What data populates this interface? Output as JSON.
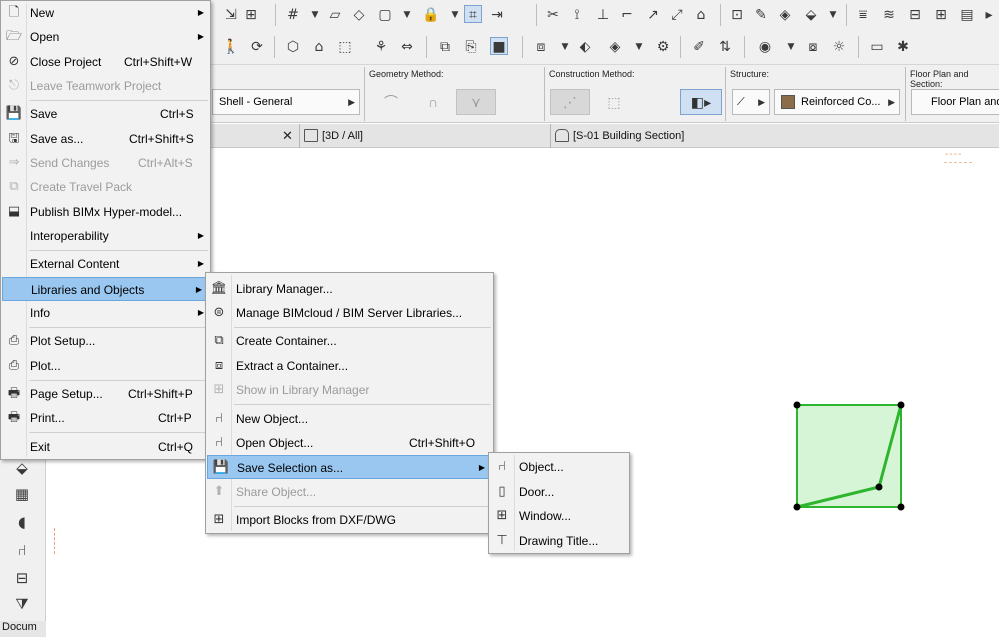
{
  "toolbar": {
    "construction_labels": {
      "geometry_method": "Geometry Method:",
      "construction_method": "Construction Method:",
      "structure": "Structure:",
      "floor_plan_section": "Floor Plan and Section:"
    },
    "shell_dropdown": "Shell - General",
    "structure_dropdown": "Reinforced Co...",
    "floor_plan_dropdown": "Floor Plan and"
  },
  "tabs": [
    {
      "label": "[3D / All]"
    },
    {
      "label": "[S-01 Building Section]"
    }
  ],
  "dash_marker": "----",
  "toolbox": {
    "document_label": "Docum"
  },
  "file_menu": {
    "items": [
      {
        "label": "New"
      },
      {
        "label": "Open"
      },
      {
        "label": "Close Project",
        "shortcut": "Ctrl+Shift+W"
      },
      {
        "label": "Leave Teamwork Project"
      },
      {
        "label": "Save",
        "shortcut": "Ctrl+S"
      },
      {
        "label": "Save as...",
        "shortcut": "Ctrl+Shift+S"
      },
      {
        "label": "Send Changes",
        "shortcut": "Ctrl+Alt+S"
      },
      {
        "label": "Create Travel Pack"
      },
      {
        "label": "Publish BIMx Hyper-model..."
      },
      {
        "label": "Interoperability"
      },
      {
        "label": "External Content"
      },
      {
        "label": "Libraries and Objects"
      },
      {
        "label": "Info"
      },
      {
        "label": "Plot Setup..."
      },
      {
        "label": "Plot..."
      },
      {
        "label": "Page Setup...",
        "shortcut": "Ctrl+Shift+P"
      },
      {
        "label": "Print...",
        "shortcut": "Ctrl+P"
      },
      {
        "label": "Exit",
        "shortcut": "Ctrl+Q"
      }
    ]
  },
  "libraries_menu": {
    "items": [
      {
        "label": "Library Manager..."
      },
      {
        "label": "Manage BIMcloud / BIM Server Libraries..."
      },
      {
        "label": "Create Container..."
      },
      {
        "label": "Extract a Container..."
      },
      {
        "label": "Show in Library Manager"
      },
      {
        "label": "New Object..."
      },
      {
        "label": "Open Object...",
        "shortcut": "Ctrl+Shift+O"
      },
      {
        "label": "Save Selection as..."
      },
      {
        "label": "Share Object..."
      },
      {
        "label": "Import Blocks from DXF/DWG"
      }
    ]
  },
  "save_selection_menu": {
    "items": [
      {
        "label": "Object..."
      },
      {
        "label": "Door..."
      },
      {
        "label": "Window..."
      },
      {
        "label": "Drawing Title..."
      }
    ]
  },
  "colors": {
    "menu_highlight": "#99c7f0",
    "shape_fill": "#d6f5d6",
    "shape_stroke": "#2db52d"
  }
}
